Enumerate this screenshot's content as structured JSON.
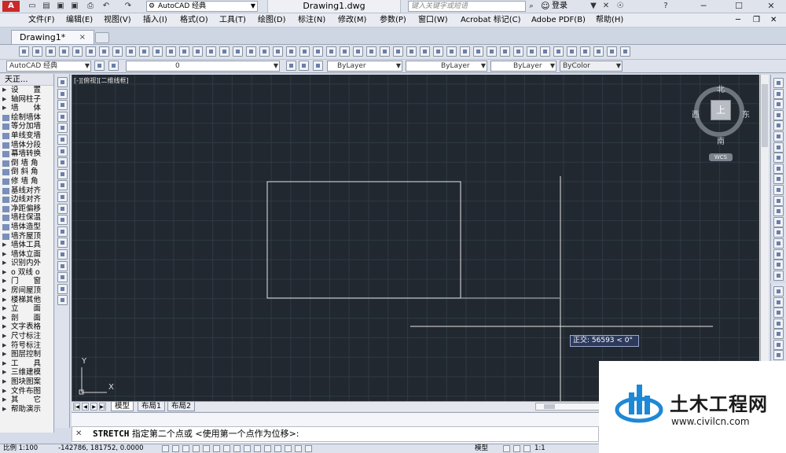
{
  "titlebar": {
    "workspace": "AutoCAD 经典",
    "doc_title": "Drawing1.dwg",
    "search_placeholder": "键入关键字或短语",
    "login": "登录",
    "help": "?"
  },
  "menubar": {
    "items": [
      "文件(F)",
      "编辑(E)",
      "视图(V)",
      "插入(I)",
      "格式(O)",
      "工具(T)",
      "绘图(D)",
      "标注(N)",
      "修改(M)",
      "参数(P)",
      "窗口(W)",
      "Acrobat 标记(C)",
      "Adobe PDF(B)",
      "帮助(H)"
    ]
  },
  "doc_tab": {
    "label": "Drawing1*",
    "close": "×"
  },
  "toolbar2": {
    "workspace": "AutoCAD 经典",
    "layer": "0",
    "color": "ByLayer",
    "linetype": "ByLayer",
    "lineweight": "ByLayer",
    "plotstyle": "ByColor"
  },
  "tz_panel": {
    "title": "天正...",
    "items": [
      "设　　置",
      "轴网柱子",
      "墙　　体",
      "绘制墙体",
      "等分加墙",
      "单线变墙",
      "墙体分段",
      "幕墙转换",
      "倒 墙 角",
      "倒 斜 角",
      "修 墙 角",
      "基线对齐",
      "边线对齐",
      "净距偏移",
      "墙柱保温",
      "墙体造型",
      "墙齐屋顶",
      "墙体工具",
      "墙体立面",
      "识别内外",
      "o 双线 o",
      "门　　窗",
      "房间屋顶",
      "楼梯其他",
      "立　　面",
      "剖　　面",
      "文字表格",
      "尺寸标注",
      "符号标注",
      "图层控制",
      "工　　具",
      "三维建模",
      "图块图案",
      "文件布图",
      "其　　它",
      "帮助演示"
    ]
  },
  "canvas": {
    "view_label": "[-][俯视][二维线框]",
    "viewcube": {
      "top": "上",
      "north": "北",
      "south": "南",
      "east": "东",
      "west": "西",
      "wcs": "WCS"
    },
    "tooltip": "正交: 56593 < 0°",
    "ucs_x": "X",
    "ucs_y": "Y"
  },
  "layout_tabs": [
    "模型",
    "布局1",
    "布局2"
  ],
  "command": {
    "close": "✕",
    "name": "STRETCH",
    "prompt": "指定第二个点或 <使用第一个点作为位移>:"
  },
  "statusbar": {
    "scale": "比例 1:100",
    "coords": "-142786, 181752, 0.0000",
    "model": "模型",
    "annot_scale": "1:1"
  },
  "watermark": {
    "name": "土木工程网",
    "url": "www.civilcn.com"
  }
}
